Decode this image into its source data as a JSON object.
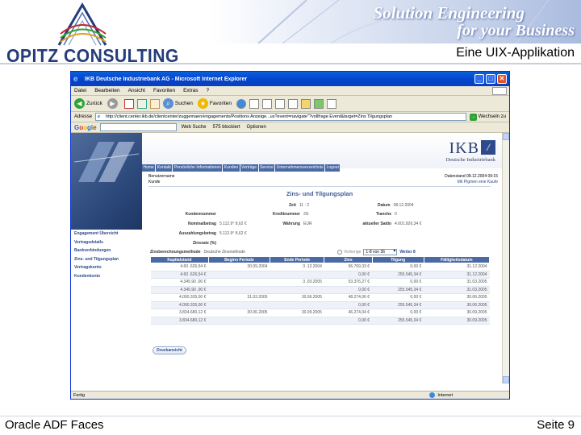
{
  "slide": {
    "logo_text": "OPITZ CONSULTING",
    "banner_line1": "Solution Engineering",
    "banner_line2": "for your Business",
    "title": "Eine UIX-Applikation",
    "footer_left": "Oracle ADF Faces",
    "footer_right": "Seite 9"
  },
  "browser": {
    "window_title": "IKB Deutsche Industriebank AG - Microsoft Internet Explorer",
    "menu": [
      "Datei",
      "Bearbeiten",
      "Ansicht",
      "Favoriten",
      "Extras",
      "?"
    ],
    "toolbar": {
      "back": "Zurück",
      "search": "Suchen",
      "favorites": "Favoriten"
    },
    "address_label": "Adresse",
    "address_value": "http://client.center.ikb.de/clientcenter/zuggemaen/engagements/Positions Anzeige...us?event=navigate\"?vollfrage Event&target=Zins Tilgungsplan",
    "go_label": "Wechseln zu",
    "google": {
      "search_label": "Web Suche",
      "blocked_label": "575 blockiert",
      "options_label": "Optionen"
    },
    "status": {
      "text": "Fertig",
      "zone": "Internet"
    },
    "colors": {
      "titlebar": "#0346d1",
      "chrome": "#ece9d8"
    }
  },
  "app": {
    "brand": "IKB",
    "brand_sub": "Deutsche Industriebank",
    "nav": [
      "Home",
      "Kontakt",
      "Persönliche Informationen",
      "Kunden",
      "Verträge",
      "Service",
      "Unternehmensverzeichnis",
      "Logout"
    ],
    "user_label": "Benutzername",
    "customer_label": "Kunde",
    "date_line": "Datenstand 08.12.2004 09:15",
    "portal_link": "Mit Pigmen eine Kaufe",
    "sidebar": [
      "Engagement Übersicht",
      "Vertragsdetails",
      "Bankverbindungen",
      "Zins- und Tilgungsplan",
      "Vertragskonto",
      "Kundenkonto"
    ],
    "heading": "Zins- und Tilgungsplan",
    "fields": {
      "zeit_label": "Zeit",
      "zeit_value": "11 : 2",
      "datum_label": "Datum",
      "datum_value": "08.12.2004",
      "kundennummer_label": "Kundennummer",
      "kundennummer_value": "",
      "kreditnummer_label": "Kreditnummer",
      "kreditnummer_value": "2G",
      "tranche_label": "Tranche",
      "tranche_value": "0",
      "nominal_label": "Nominalbetrag",
      "nominal_value": "5.112.9° 8,62 €",
      "waehrung_label": "Währung",
      "waehrung_value": "EUR",
      "saldo_label": "aktueller Saldo",
      "saldo_value": "4.601.826,34 €",
      "auszahlung_label": "Auszahlungsbetrag",
      "auszahlung_value": "5.112.9° 8,62 €",
      "zinssatz_label": "Zinssatz (%)",
      "zinssatz_value": "",
      "methode_label": "Zinsberechnungsmethode",
      "methode_value": "Deutsche Zinsmethode"
    },
    "pager": {
      "prev": "Vorherige",
      "range": "1-8 von 36",
      "next": "Weiter 8"
    },
    "table": {
      "columns": [
        "Kapitalstand",
        "Beginn Periode",
        "Ende Periode",
        "Zins",
        "Tilgung",
        "Fälligkeitsdatum"
      ],
      "rows": [
        [
          "4.60 .626,54 €",
          "30.09.2004",
          "3 .12.2004",
          "56.769,33 €",
          "0,00 €",
          "31.12.2004"
        ],
        [
          "4.60 .626,54 €",
          "",
          "",
          "0,00 €",
          "255.545,34 €",
          "31.12.2004"
        ],
        [
          "4.345.90 ,00 €",
          "",
          "3 .03.2005",
          "53.376,27 €",
          "0,00 €",
          "31.03.2005"
        ],
        [
          "4.345.90 ,00 €",
          "",
          "",
          "0,00 €",
          "255.545,34 €",
          "31.03.2005"
        ],
        [
          "4.090.335,00 €",
          "31.03.2005",
          "30.06.2005",
          "48.274,06 €",
          "0,00 €",
          "30.06.2005"
        ],
        [
          "4.090.335,00 €",
          "",
          "",
          "0,00 €",
          "255.545,34 €",
          "30.06.2005"
        ],
        [
          "3.834.680,12 €",
          "30.06.2005",
          "30.09.2005",
          "46.274,04 €",
          "0,00 €",
          "30.09.2005"
        ],
        [
          "3.834.680,12 €",
          "",
          "",
          "0,00 €",
          "255.545,34 €",
          "30.09.2005"
        ]
      ]
    },
    "print_button": "Druckansicht"
  }
}
